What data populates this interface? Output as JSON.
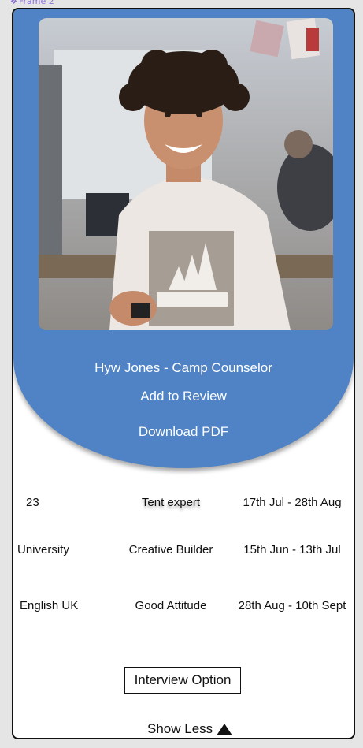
{
  "frame": {
    "label": "Frame 2"
  },
  "profile": {
    "title": "Hyw Jones - Camp Counselor",
    "add_to_review": "Add to Review",
    "download_pdf": "Download PDF"
  },
  "details": {
    "rows": [
      [
        "23",
        "Tent expert",
        "17th Jul - 28th Aug"
      ],
      [
        "University",
        "Creative Builder",
        "15th Jun - 13th Jul"
      ],
      [
        "English UK",
        "Good Attitude",
        "28th Aug - 10th Sept"
      ]
    ]
  },
  "actions": {
    "interview_option": "Interview Option",
    "show_less": "Show Less"
  },
  "colors": {
    "header_bg": "#4f83c6",
    "card_bg": "#ffffff",
    "page_bg": "#e5e5e5"
  },
  "icons": {
    "frame": "frame-diamond-icon",
    "show_less": "triangle-up-icon"
  }
}
